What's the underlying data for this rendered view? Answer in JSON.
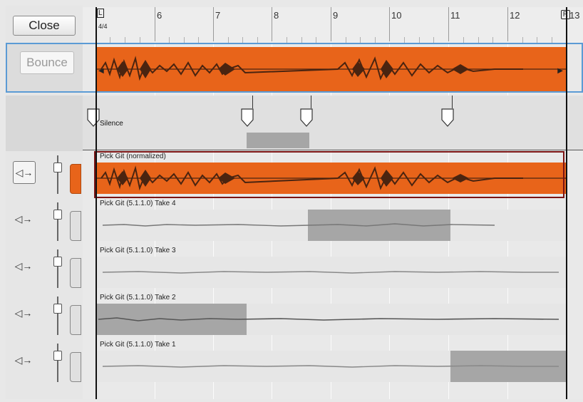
{
  "toolbar": {
    "close_label": "Close",
    "bounce_label": "Bounce"
  },
  "ruler": {
    "bars": [
      "6",
      "7",
      "8",
      "9",
      "10",
      "11",
      "12",
      "13"
    ],
    "left_locator": "L",
    "right_locator": "R",
    "time_signature": "4/4"
  },
  "silence": {
    "label": "Silence"
  },
  "tracks": [
    {
      "label": "Pick Git (normalized)",
      "active": true
    },
    {
      "label": "Pick Git (5.1.1.0) Take 4"
    },
    {
      "label": "Pick Git (5.1.1.0) Take 3"
    },
    {
      "label": "Pick Git (5.1.1.0) Take 2"
    },
    {
      "label": "Pick Git (5.1.1.0) Take 1"
    }
  ],
  "colors": {
    "accent": "#e8641a",
    "selection_frame": "#5b9bd5",
    "active_take_frame": "#7b1414"
  },
  "icons": {
    "speaker": "speaker-arrow-icon",
    "fader": "fader-icon",
    "marker": "silence-marker-icon"
  }
}
